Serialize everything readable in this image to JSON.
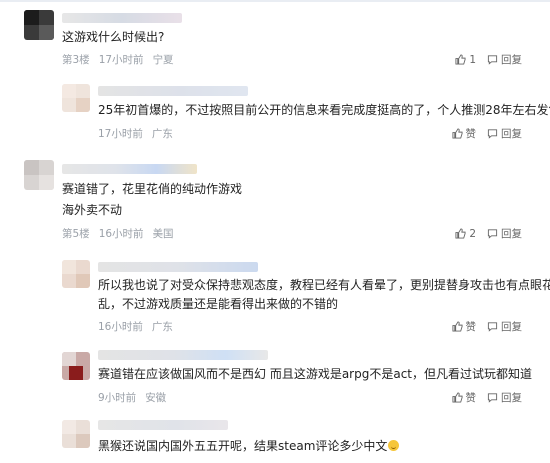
{
  "colors": {
    "meta": "#9aa0a8",
    "text": "#222222",
    "action": "#666666"
  },
  "comments": [
    {
      "text": "这游戏什么时候出?",
      "floor": "第3楼",
      "time": "17小时前",
      "location": "宁夏",
      "likes": "1",
      "reply": "回复"
    },
    {
      "text": "25年初首爆的，不过按照目前公开的信息来看完成度挺高的了，个人推测28年左右发售",
      "time": "17小时前",
      "location": "广东",
      "like_label": "赞",
      "reply": "回复"
    },
    {
      "text_line1": "赛道错了，花里花俏的纯动作游戏",
      "text_line2": "海外卖不动",
      "floor": "第5楼",
      "time": "16小时前",
      "location": "美国",
      "likes": "2",
      "reply": "回复"
    },
    {
      "text_line1": "所以我也说了对受众保持悲观态度，教程已经有人看晕了，更别提替身攻击也有点眼花缭",
      "text_line2": "乱，不过游戏质量还是能看得出来做的不错的",
      "time": "16小时前",
      "location": "广东",
      "like_label": "赞",
      "reply": "回复"
    },
    {
      "text": "赛道错在应该做国风而不是西幻 而且这游戏是arpg不是act，但凡看过试玩都知道",
      "time": "9小时前",
      "location": "安徽",
      "like_label": "赞",
      "reply": "回复"
    },
    {
      "text": "黑猴还说国内国外五五开呢，结果steam评论多少中文"
    }
  ]
}
